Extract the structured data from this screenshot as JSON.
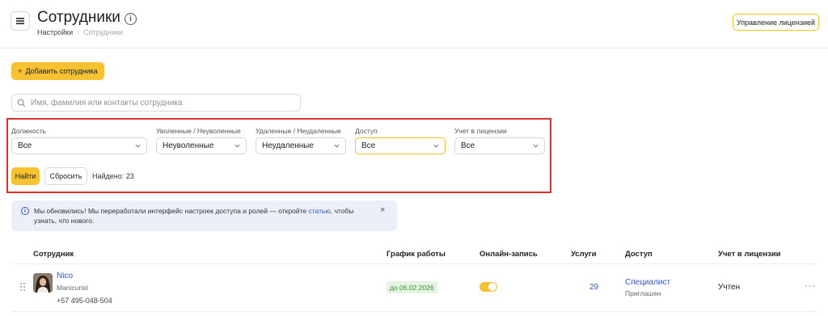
{
  "header": {
    "title": "Сотрудники",
    "info_icon": "i",
    "breadcrumb": [
      "Настройки",
      "Сотрудники"
    ],
    "license_button": "Управление лицензией"
  },
  "toolbar": {
    "add_button": "Добавить сотрудника",
    "add_icon": "+"
  },
  "search": {
    "placeholder": "Имя, фамилия или контакты сотрудника"
  },
  "filters": {
    "items": [
      {
        "label": "Должность",
        "value": "Все"
      },
      {
        "label": "Уволенные / Неуволенные",
        "value": "Неуволенные"
      },
      {
        "label": "Удаленные / Неудаленные",
        "value": "Неудаленные"
      },
      {
        "label": "Доступ",
        "value": "Все"
      },
      {
        "label": "Учет в лицензии",
        "value": "Все"
      }
    ],
    "find_button": "Найти",
    "reset_button": "Сбросить",
    "found_text": "Найдено: 23"
  },
  "notice": {
    "text_before": "Мы обновились! Мы переработали интерфейс настроек доступа и ролей — откройте ",
    "link": "статью",
    "text_after": ", чтобы узнать, что нового.",
    "close": "×"
  },
  "table": {
    "columns": [
      "Сотрудник",
      "График работы",
      "Онлайн-запись",
      "Услуги",
      "Доступ",
      "Учет в лицензии"
    ],
    "rows": [
      {
        "name": "Nico",
        "role": "Manicurist",
        "phone": "+57 495-048-504",
        "schedule": "до 06.02.2026",
        "online_booking": true,
        "services": "29",
        "access": "Специалист",
        "access_status": "Приглашен",
        "license": "Учтен",
        "more": "···"
      }
    ]
  },
  "colors": {
    "accent": "#f7c230",
    "link": "#2f56d6",
    "highlight_border": "#d9322b",
    "notice_bg": "#eceef8",
    "badge_bg": "#e4f5e1",
    "badge_text": "#3d8a35"
  }
}
